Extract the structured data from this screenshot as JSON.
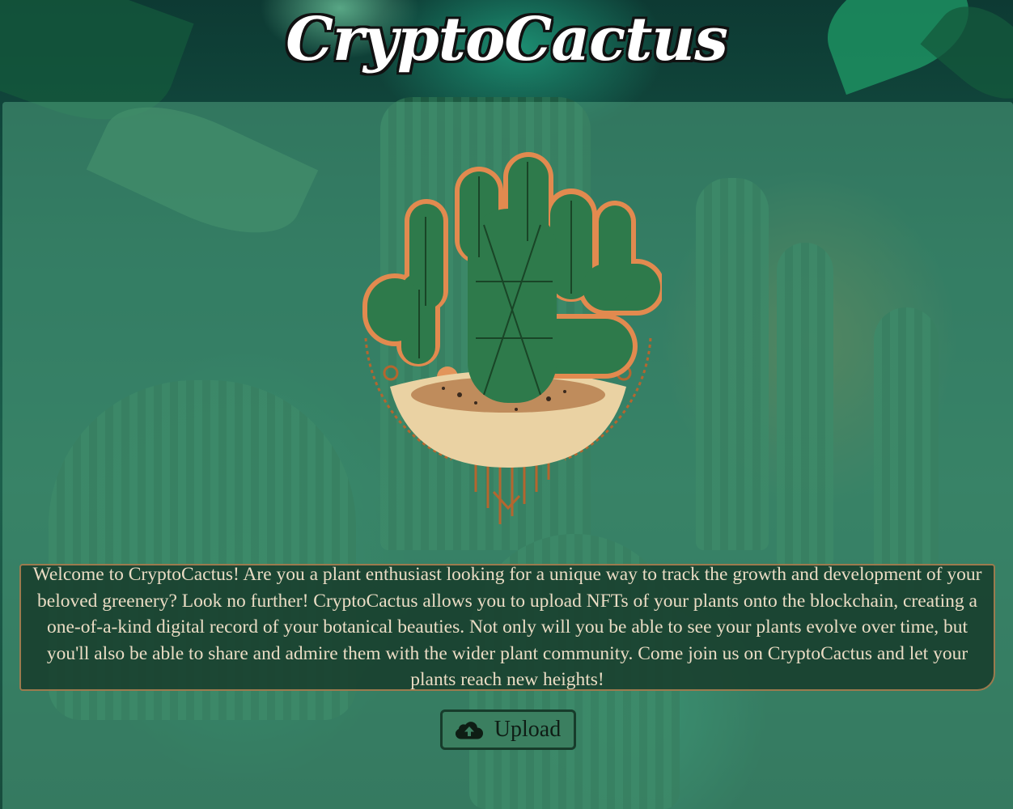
{
  "header": {
    "title": "CryptoCactus"
  },
  "emblem": {
    "icon": "cactus-emblem-icon"
  },
  "welcome": {
    "text": "Welcome to CryptoCactus! Are you a plant enthusiast looking for a unique way to track the growth and development of your beloved greenery? Look no further! CryptoCactus allows you to upload NFTs of your plants onto the blockchain, creating a one-of-a-kind digital record of your botanical beauties. Not only will you be able to see your plants evolve over time, but you'll also be able to share and admire them with the wider plant community. Come join us on CryptoCactus and let your plants reach new heights!"
  },
  "upload": {
    "label": "Upload",
    "icon": "cloud-upload-icon"
  },
  "colors": {
    "panel": "#4ea07d",
    "text_box": "#183e2c",
    "text_box_border": "#9c7a4e",
    "text": "#eadcc4",
    "button": "#3b7f60",
    "button_border": "#173c2b"
  }
}
